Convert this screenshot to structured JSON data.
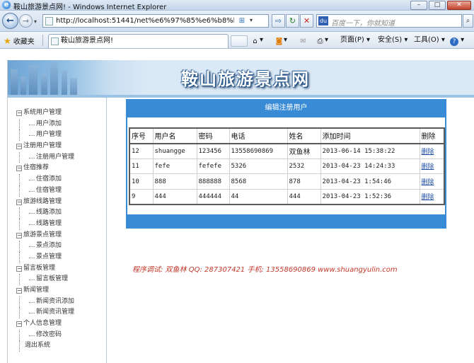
{
  "window": {
    "title": "鞍山旅游景点网! - Windows Internet Explorer",
    "controls": {
      "minimize": "–",
      "maximize": "□",
      "close": "✕"
    }
  },
  "addressbar": {
    "url": "http://localhost:51441/net%e6%97%85%e6%b8%b8shfw%e",
    "search_placeholder": "百度一下，你就知道"
  },
  "commandbar": {
    "favorites_label": "收藏夹",
    "tab_title": "鞍山旅游景点网!",
    "page_menu": "页面(P)",
    "safety_menu": "安全(S)",
    "tools_menu": "工具(O)",
    "help_menu": "?"
  },
  "site": {
    "title": "鞍山旅游景点网",
    "credit": "程序调试: 双鱼林    QQ: 287307421    手机: 13558690869    www.shuangyulin.com"
  },
  "sidebar": {
    "groups": [
      {
        "label": "系统用户管理",
        "items": [
          "用户添加",
          "用户管理"
        ]
      },
      {
        "label": "注册用户管理",
        "items": [
          "注册用户管理"
        ]
      },
      {
        "label": "住宿推荐",
        "items": [
          "住宿添加",
          "住宿管理"
        ]
      },
      {
        "label": "旅游线路管理",
        "items": [
          "线路添加",
          "线路管理"
        ]
      },
      {
        "label": "旅游景点管理",
        "items": [
          "景点添加",
          "景点管理"
        ]
      },
      {
        "label": "留言板管理",
        "items": [
          "留言板管理"
        ]
      },
      {
        "label": "新闻管理",
        "items": [
          "新闻资讯添加",
          "新闻资讯管理"
        ]
      },
      {
        "label": "个人信息管理",
        "items": [
          "修改密码"
        ]
      }
    ],
    "logout": "退出系统"
  },
  "panel": {
    "title": "编辑注册用户",
    "columns": [
      "序号",
      "用户名",
      "密码",
      "电话",
      "姓名",
      "添加时间",
      "删除"
    ],
    "rows": [
      {
        "id": "12",
        "username": "shuangge",
        "password": "123456",
        "phone": "13558690869",
        "name": "双鱼林",
        "added": "2013-06-14 15:38:22",
        "delete": "删除"
      },
      {
        "id": "11",
        "username": "fefe",
        "password": "fefefe",
        "phone": "5326",
        "name": "2532",
        "added": "2013-04-23 14:24:33",
        "delete": "删除"
      },
      {
        "id": "10",
        "username": "888",
        "password": "888888",
        "phone": "8568",
        "name": "878",
        "added": "2013-04-23 1:54:46",
        "delete": "删除"
      },
      {
        "id": "9",
        "username": "444",
        "password": "444444",
        "phone": "44",
        "name": "444",
        "added": "2013-04-23 1:52:36",
        "delete": "删除"
      }
    ]
  }
}
